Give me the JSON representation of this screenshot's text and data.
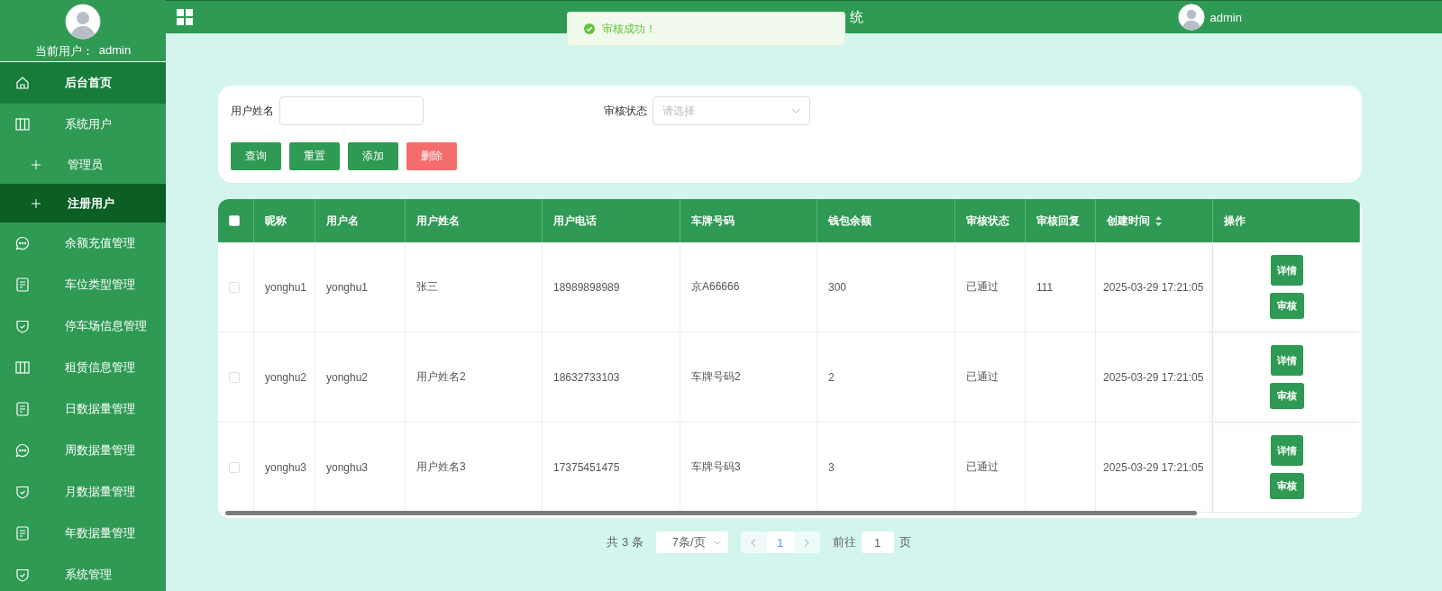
{
  "sidebar": {
    "current_user_label": "当前用户：",
    "current_user": "admin",
    "items": [
      {
        "label": "后台首页",
        "kind": "menu",
        "selected": false,
        "hovered": true
      },
      {
        "label": "系统用户",
        "kind": "menu",
        "selected": false,
        "hovered": false
      },
      {
        "label": "管理员",
        "kind": "submenu",
        "selected": false,
        "hovered": false
      },
      {
        "label": "注册用户",
        "kind": "submenu",
        "selected": true,
        "hovered": false
      },
      {
        "label": "余额充值管理",
        "kind": "menu",
        "selected": false,
        "hovered": false
      },
      {
        "label": "车位类型管理",
        "kind": "menu",
        "selected": false,
        "hovered": false
      },
      {
        "label": "停车场信息管理",
        "kind": "menu",
        "selected": false,
        "hovered": false
      },
      {
        "label": "租赁信息管理",
        "kind": "menu",
        "selected": false,
        "hovered": false
      },
      {
        "label": "日数据量管理",
        "kind": "menu",
        "selected": false,
        "hovered": false
      },
      {
        "label": "周数据量管理",
        "kind": "menu",
        "selected": false,
        "hovered": false
      },
      {
        "label": "月数据量管理",
        "kind": "menu",
        "selected": false,
        "hovered": false
      },
      {
        "label": "年数据量管理",
        "kind": "menu",
        "selected": false,
        "hovered": false
      },
      {
        "label": "系统管理",
        "kind": "menu",
        "selected": false,
        "hovered": false
      }
    ]
  },
  "header": {
    "title": "统",
    "user": "admin"
  },
  "toast": {
    "message": "审核成功！"
  },
  "search": {
    "fields": [
      {
        "label": "用户姓名",
        "kind": "input"
      },
      {
        "label": "审核状态",
        "kind": "select",
        "placeholder": "请选择"
      }
    ],
    "buttons": [
      {
        "label": "查询",
        "kind": "primary"
      },
      {
        "label": "重置",
        "kind": "primary"
      },
      {
        "label": "添加",
        "kind": "primary"
      },
      {
        "label": "删除",
        "kind": "danger"
      }
    ]
  },
  "table": {
    "select_all": {
      "checked": false
    },
    "columns": [
      {
        "label": "昵称",
        "sortable": false
      },
      {
        "label": "用户名",
        "sortable": false
      },
      {
        "label": "用户姓名",
        "sortable": false
      },
      {
        "label": "用户电话",
        "sortable": false
      },
      {
        "label": "车牌号码",
        "sortable": false
      },
      {
        "label": "钱包余额",
        "sortable": false
      },
      {
        "label": "审核状态",
        "sortable": false
      },
      {
        "label": "审核回复",
        "sortable": false
      },
      {
        "label": "创建时间",
        "sortable": true
      },
      {
        "label": "操作",
        "sortable": false
      }
    ],
    "rows": [
      {
        "checked": false,
        "cells": [
          "yonghu1",
          "yonghu1",
          "张三",
          "18989898989",
          "京A66666",
          "300",
          "已通过",
          "111",
          "2025-03-29 17:21:05"
        ],
        "actions": [
          "详情",
          "审核"
        ]
      },
      {
        "checked": false,
        "cells": [
          "yonghu2",
          "yonghu2",
          "用户姓名2",
          "18632733103",
          "车牌号码2",
          "2",
          "已通过",
          "",
          "2025-03-29 17:21:05"
        ],
        "actions": [
          "详情",
          "审核"
        ]
      },
      {
        "checked": false,
        "cells": [
          "yonghu3",
          "yonghu3",
          "用户姓名3",
          "17375451475",
          "车牌号码3",
          "3",
          "已通过",
          "",
          "2025-03-29 17:21:05"
        ],
        "actions": [
          "详情",
          "审核"
        ]
      }
    ]
  },
  "pagination": {
    "total": "共 3 条",
    "page_size": "7条/页",
    "pages": [
      {
        "label": "1",
        "selected": true
      }
    ],
    "goto_label": "前往",
    "goto_value": "1",
    "goto_suffix": "页"
  }
}
